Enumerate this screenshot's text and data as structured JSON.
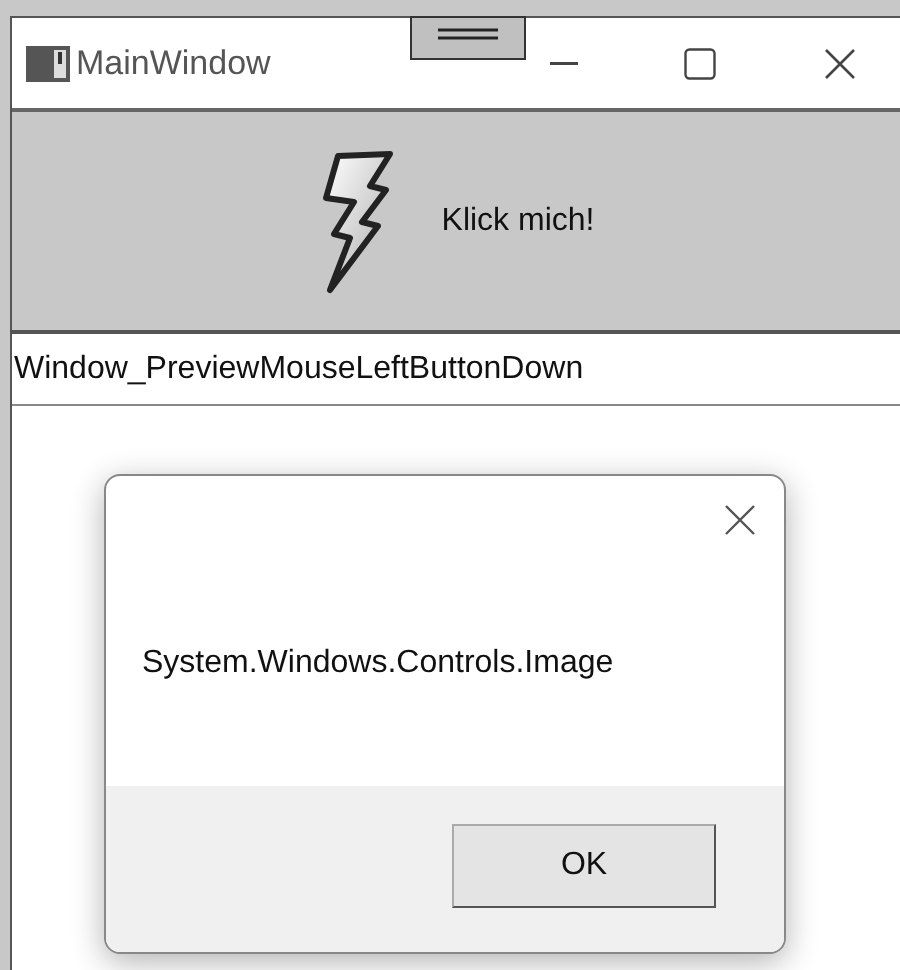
{
  "window": {
    "title": "MainWindow"
  },
  "button": {
    "label": "Klick mich!"
  },
  "output": {
    "text": "Window_PreviewMouseLeftButtonDown"
  },
  "dialog": {
    "message": "System.Windows.Controls.Image",
    "buttons": [
      "OK"
    ]
  }
}
